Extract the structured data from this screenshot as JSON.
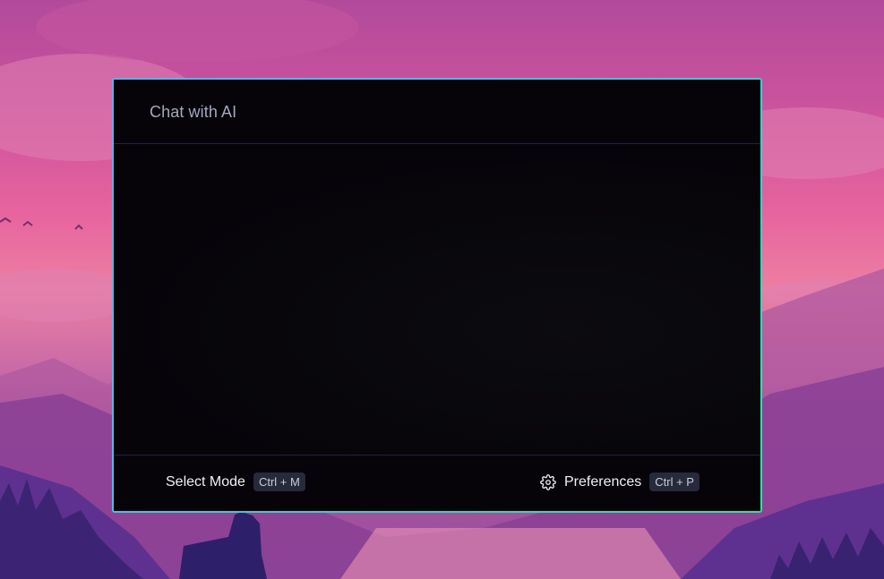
{
  "window": {
    "title": "Chat with AI"
  },
  "footer": {
    "mode_label": "Select Mode",
    "mode_shortcut": "Ctrl + M",
    "prefs_label": "Preferences",
    "prefs_shortcut": "Ctrl + P",
    "prefs_icon": "gear-icon"
  },
  "colors": {
    "border_start": "#4fb6e8",
    "border_end": "#2fe0a3",
    "window_bg": "#060409",
    "title_text": "#a4a7bd",
    "kbd_bg": "#262a3a"
  }
}
